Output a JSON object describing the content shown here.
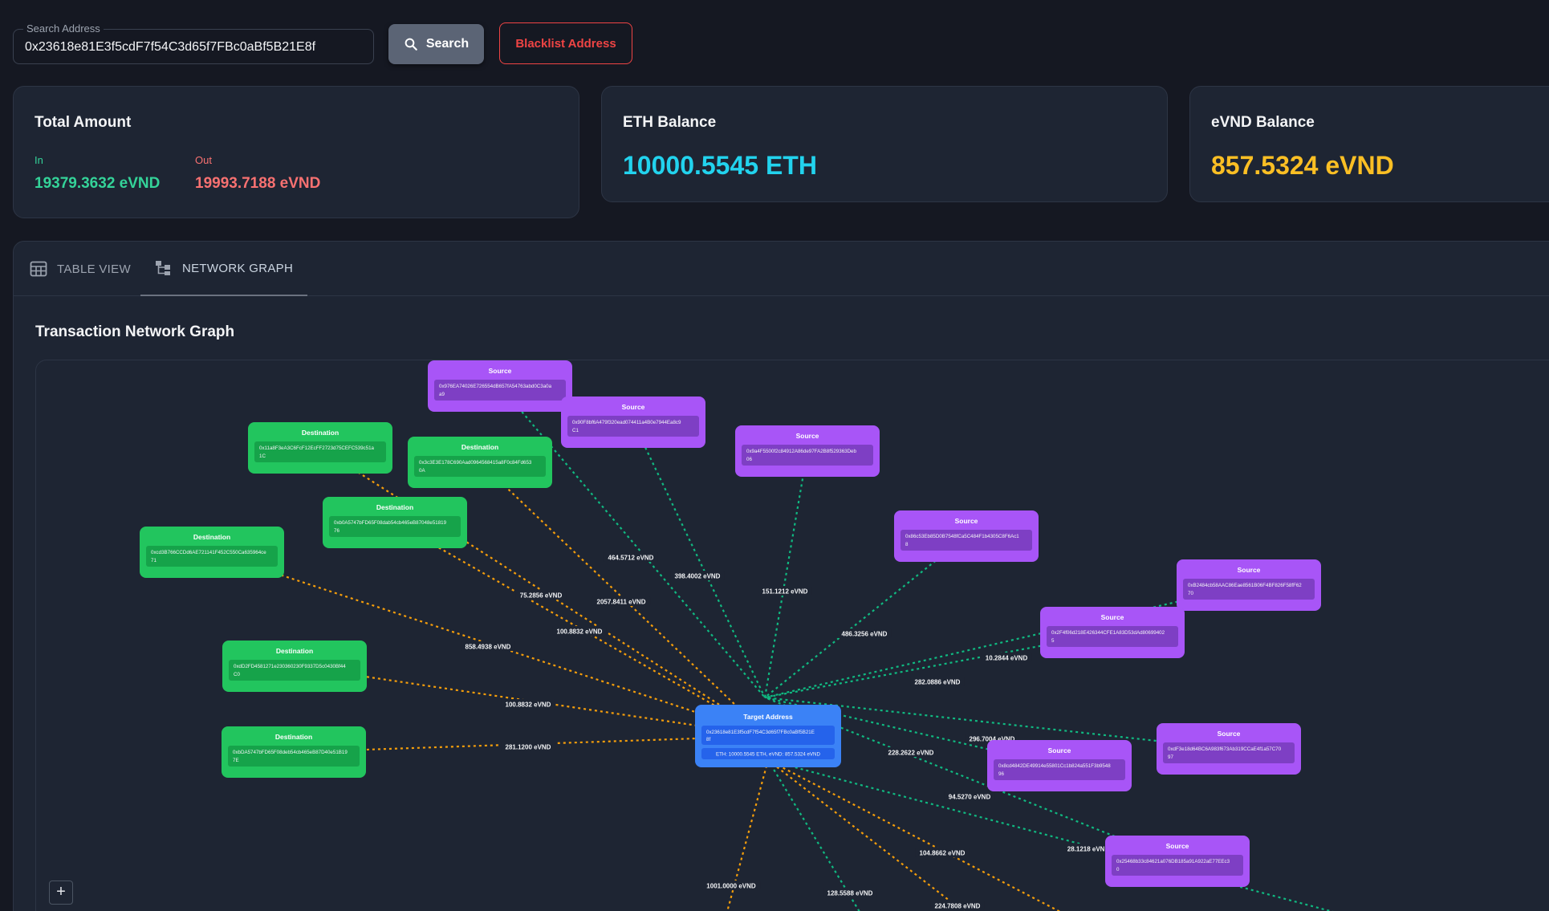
{
  "search": {
    "label": "Search Address",
    "value": "0x23618e81E3f5cdF7f54C3d65f7FBc0aBf5B21E8f",
    "button_label": "Search",
    "blacklist_label": "Blacklist Address"
  },
  "cards": {
    "total": {
      "title": "Total Amount",
      "in_label": "In",
      "in_value": "19379.3632 eVND",
      "out_label": "Out",
      "out_value": "19993.7188 eVND"
    },
    "eth": {
      "title": "ETH Balance",
      "value": "10000.5545 ETH"
    },
    "evnd": {
      "title": "eVND Balance",
      "value": "857.5324 eVND"
    }
  },
  "tabs": {
    "table": "TABLE VIEW",
    "graph": "NETWORK GRAPH"
  },
  "graph": {
    "title": "Transaction Network Graph",
    "zoom_in": "+",
    "colors": {
      "source": "#a855f7",
      "destination": "#22c55e",
      "target": "#3b82f6",
      "out_edge": "#f59e0b",
      "in_edge": "#10b981"
    },
    "target": {
      "title": "Target Address",
      "address": "0x23618e81E3f5cdF7f54C3d65f7FBc0aBf5B21E8f",
      "balance": "ETH: 10000.5545 ETH, eVND: 857.5324 eVND"
    },
    "nodes": [
      {
        "kind": "Source",
        "address": "0x976EA74026E726554dB657fA54763abd0C3a0aa9"
      },
      {
        "kind": "Source",
        "address": "0x90F8bf6A479f320ead074411a4B0e7944Ea8c9C1"
      },
      {
        "kind": "Source",
        "address": "0x9a4F5500f2c84912A86de97FA2B8f529363Deb06"
      },
      {
        "kind": "Destination",
        "address": "0x11a8F3eA3C6FcF12EcFF2723d75CEFC539c51a1C"
      },
      {
        "kind": "Destination",
        "address": "0x3c3E3E178C690Aad0964568415a8F0c84Fd6530A"
      },
      {
        "kind": "Destination",
        "address": "0xb0A5747bFD65F08dab54cb465eB87048e5181976"
      },
      {
        "kind": "Destination",
        "address": "0xcd3B766CCDd6AE721141F452C550Ca635964ce71"
      },
      {
        "kind": "Source",
        "address": "0x86c53Eb85D0B7548fCa5C484F1b4305C8F6Ac18"
      },
      {
        "kind": "Source",
        "address": "0xB2484cb58AAC86Eae8561B06F4BF826F58fF6270"
      },
      {
        "kind": "Source",
        "address": "0x2F4f06d218E426344CFE1A83D53dAd806994025"
      },
      {
        "kind": "Destination",
        "address": "0xdD2FD4581271e230360230F9337D5c0430Bf44C0"
      },
      {
        "kind": "Destination",
        "address": "0xbDA5747bFD65F08deb54cb465eB87D40e51B197E"
      },
      {
        "kind": "Source",
        "address": "0x8cd4842DE49914e55801Cc1b824a551F3b954896"
      },
      {
        "kind": "Source",
        "address": "0xdF3e18d64BC6A983f673Ab319CCaE4f1a57C7097"
      },
      {
        "kind": "Source",
        "address": "0x25468b33c84621a076DB185a91A922aE77EEc30"
      }
    ],
    "edge_labels": [
      "464.5712 eVND",
      "398.4002 eVND",
      "151.1212 eVND",
      "75.2856 eVND",
      "2057.8411 eVND",
      "100.8832 eVND",
      "858.4938 eVND",
      "486.3256 eVND",
      "10.2844 eVND",
      "282.0886 eVND",
      "100.8832 eVND",
      "281.1200 eVND",
      "296.7004 eVND",
      "228.2622 eVND",
      "94.5270 eVND",
      "104.8662 eVND",
      "28.1218 eVND",
      "1001.0000 eVND",
      "128.5588 eVND",
      "224.7808 eVND"
    ]
  }
}
